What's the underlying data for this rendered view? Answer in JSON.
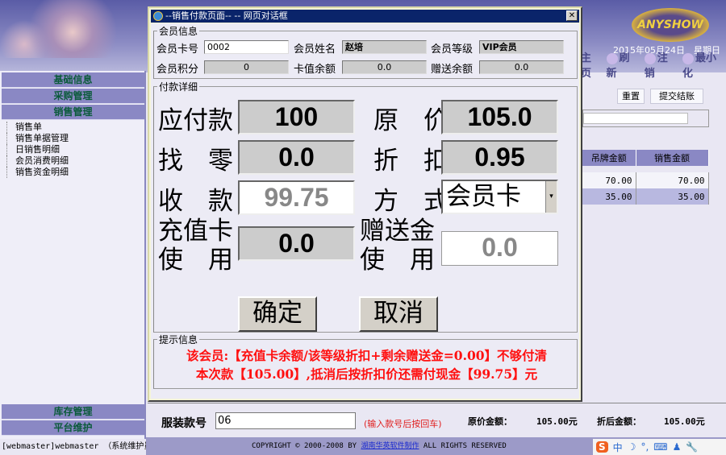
{
  "header": {
    "logo": "ANYSHOW",
    "date": "2015年05月24日　星期日",
    "toolbar": [
      "主页",
      "刷新",
      "注销",
      "最小化"
    ]
  },
  "sidebar": {
    "menus": [
      "基础信息",
      "采购管理",
      "销售管理"
    ],
    "sales_items": [
      "销售单",
      "销售单据管理",
      "日销售明细",
      "会员消费明细",
      "销售资金明细"
    ],
    "bottom_menus": [
      "库存管理",
      "平台维护"
    ],
    "user": "[webmaster]webmaster （系统维护员）"
  },
  "main": {
    "reset": "重置",
    "submit": "提交结账",
    "columns": [
      "吊牌金额",
      "销售金额"
    ],
    "rows": [
      [
        "70.00",
        "70.00"
      ],
      [
        "35.00",
        "35.00"
      ]
    ],
    "style_label": "服装款号",
    "style_value": "06",
    "style_hint": "(输入款号后按回车)",
    "orig_label": "原价金额：",
    "orig_value": "105.00元",
    "disc_label": "折后金额：",
    "disc_value": "105.00元"
  },
  "footer": {
    "pre": "COPYRIGHT © 2000-2008 BY ",
    "link": "湖南华英软件制作",
    "post": " ALL RIGHTS RESERVED"
  },
  "ime": {
    "logo": "S",
    "items": [
      "中",
      "☽",
      "°,",
      "⌨",
      "♟",
      "🔧"
    ]
  },
  "dialog": {
    "title": "--销售付款页面-- -- 网页对话框",
    "close": "✕",
    "member": {
      "legend": "会员信息",
      "card_label": "会员卡号",
      "card_value": "0002",
      "name_label": "会员姓名",
      "name_value": "赵培",
      "level_label": "会员等级",
      "level_value": "VIP会员",
      "points_label": "会员积分",
      "points_value": "0",
      "balance_label": "卡值余额",
      "balance_value": "0.0",
      "gift_label": "赠送余额",
      "gift_value": "0.0"
    },
    "payment": {
      "legend": "付款详细",
      "due_label": "应付款",
      "due_value": "100",
      "orig_label": "原　价",
      "orig_value": "105.0",
      "change_label": "找　零",
      "change_value": "0.0",
      "discount_label": "折　扣",
      "discount_value": "0.95",
      "received_label": "收　款",
      "received_value": "99.75",
      "method_label": "方　式",
      "method_value": "会员卡",
      "card_use_label1": "充值卡",
      "card_use_label2": "使　用",
      "card_use_value": "0.0",
      "gift_use_label1": "赠送金",
      "gift_use_label2": "使　用",
      "gift_use_value": "0.0",
      "ok": "确定",
      "cancel": "取消"
    },
    "info": {
      "legend": "提示信息",
      "line1": "该会员:【充值卡余额/该等级折扣+剩余赠送金=0.00】不够付清",
      "line2": "本次款【105.00】,抵消后按折扣价还需付现金【99.75】元"
    }
  }
}
